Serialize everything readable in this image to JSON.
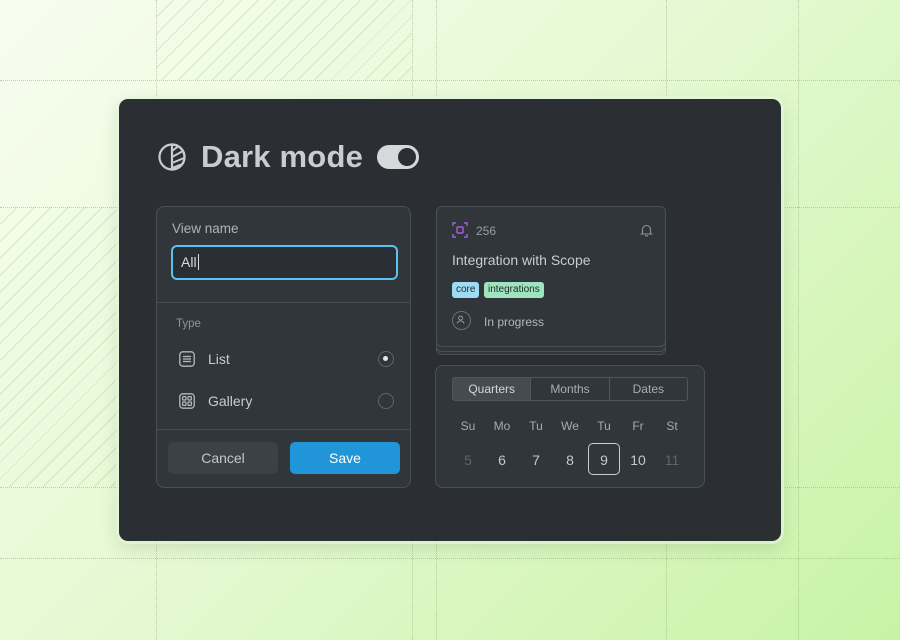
{
  "header": {
    "title": "Dark mode",
    "toggle_on": true
  },
  "view_form": {
    "name_label": "View name",
    "name_value": "All",
    "type_label": "Type",
    "options": [
      {
        "label": "List",
        "selected": true,
        "icon": "list-icon"
      },
      {
        "label": "Gallery",
        "selected": false,
        "icon": "gallery-icon"
      }
    ],
    "cancel_label": "Cancel",
    "save_label": "Save"
  },
  "issue_card": {
    "number": "256",
    "title": "Integration with Scope",
    "tags": [
      "core",
      "integrations"
    ],
    "status": "In progress"
  },
  "calendar": {
    "tabs": [
      "Quarters",
      "Months",
      "Dates"
    ],
    "active_tab": "Quarters",
    "weekdays": [
      "Su",
      "Mo",
      "Tu",
      "We",
      "Tu",
      "Fr",
      "St"
    ],
    "days": [
      "5",
      "6",
      "7",
      "8",
      "9",
      "10",
      "11"
    ],
    "selected_day": "9"
  },
  "colors": {
    "accent": "#2096d8",
    "input_focus": "#58c3f0",
    "panel": "#2b2f33"
  }
}
